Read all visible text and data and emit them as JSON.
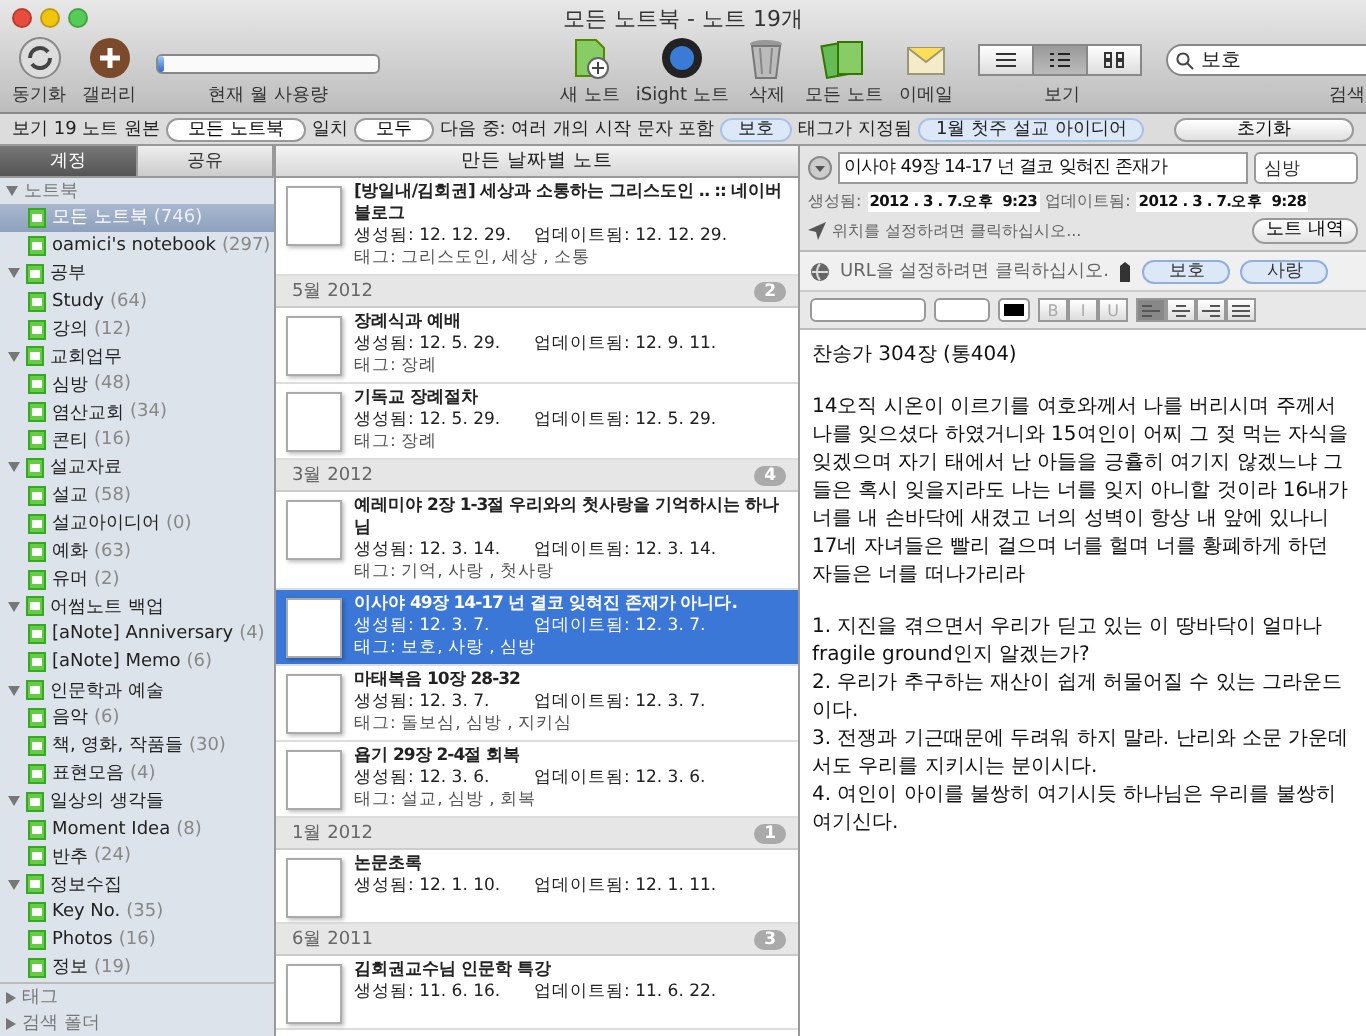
{
  "window": {
    "title": "모든 노트북 - 노트 19개"
  },
  "toolbar": {
    "items": [
      {
        "kind": "sync",
        "label": "동기화"
      },
      {
        "kind": "gallery",
        "label": "갤러리"
      }
    ],
    "usage": {
      "label": "현재 월 사용량",
      "level": 0.03
    },
    "actions": [
      {
        "kind": "new_note",
        "label": "새 노트"
      },
      {
        "kind": "isight",
        "label": "iSight 노트"
      },
      {
        "kind": "trash",
        "label": "삭제"
      },
      {
        "kind": "all_notes",
        "label": "모든 노트"
      },
      {
        "kind": "email",
        "label": "이메일"
      }
    ],
    "view": {
      "label": "보기",
      "options": [
        {
          "kind": "list",
          "selected": false
        },
        {
          "kind": "snippet",
          "selected": true
        },
        {
          "kind": "thumb",
          "selected": false
        }
      ]
    },
    "search": {
      "value": "보호",
      "label": "검색"
    }
  },
  "filter_bar": {
    "parts": [
      {
        "kind": "text",
        "text": "보기 19 노트 원본"
      },
      {
        "kind": "select",
        "text": "모든 노트북"
      },
      {
        "kind": "text",
        "text": "일치"
      },
      {
        "kind": "select",
        "text": "모두"
      },
      {
        "kind": "text",
        "text": "다음 중: 여러 개의 시작 문자 포함"
      },
      {
        "kind": "token",
        "text": "보호"
      },
      {
        "kind": "text",
        "text": "태그가 지정됨"
      },
      {
        "kind": "token",
        "text": "1월 첫주 설교 아이디어"
      }
    ],
    "reset": "초기화"
  },
  "sidebar": {
    "tabs": [
      {
        "label": "계정",
        "selected": true
      },
      {
        "label": "공유",
        "selected": false
      }
    ],
    "sections": [
      {
        "label": "노트북",
        "expanded": true,
        "children": [
          {
            "label": "모든 노트북",
            "count": "(746)",
            "selected": true
          },
          {
            "label": "oamici's notebook",
            "count": "(297)",
            "selected": false
          },
          {
            "label": "공부",
            "selected": false,
            "expanded": true,
            "children": [
              {
                "label": "Study",
                "count": "(64)",
                "selected": false
              },
              {
                "label": "강의",
                "count": "(12)",
                "selected": false
              }
            ]
          },
          {
            "label": "교회업무",
            "selected": false,
            "expanded": true,
            "children": [
              {
                "label": "심방",
                "count": "(48)",
                "selected": false
              },
              {
                "label": "염산교회",
                "count": "(34)",
                "selected": false
              },
              {
                "label": "콘티",
                "count": "(16)",
                "selected": false
              }
            ]
          },
          {
            "label": "설교자료",
            "selected": false,
            "expanded": true,
            "children": [
              {
                "label": "설교",
                "count": "(58)",
                "selected": false
              },
              {
                "label": "설교아이디어",
                "count": "(0)",
                "selected": false
              },
              {
                "label": "예화",
                "count": "(63)",
                "selected": false
              },
              {
                "label": "유머",
                "count": "(2)",
                "selected": false
              }
            ]
          },
          {
            "label": "어썸노트 백업",
            "selected": false,
            "expanded": true,
            "children": [
              {
                "label": "[aNote] Anniversary",
                "count": "(4)",
                "selected": false
              },
              {
                "label": "[aNote] Memo",
                "count": "(6)",
                "selected": false
              }
            ]
          },
          {
            "label": "인문학과 예술",
            "selected": false,
            "expanded": true,
            "children": [
              {
                "label": "음악",
                "count": "(6)",
                "selected": false
              },
              {
                "label": "책, 영화, 작품들",
                "count": "(30)",
                "selected": false
              },
              {
                "label": "표현모음",
                "count": "(4)",
                "selected": false
              }
            ]
          },
          {
            "label": "일상의 생각들",
            "selected": false,
            "expanded": true,
            "children": [
              {
                "label": "Moment Idea",
                "count": "(8)",
                "selected": false
              },
              {
                "label": "반추",
                "count": "(24)",
                "selected": false
              }
            ]
          },
          {
            "label": "정보수집",
            "selected": false,
            "expanded": true,
            "children": [
              {
                "label": "Key No.",
                "count": "(35)",
                "selected": false
              },
              {
                "label": "Photos",
                "count": "(16)",
                "selected": false
              },
              {
                "label": "정보",
                "count": "(19)",
                "selected": false
              }
            ]
          }
        ]
      },
      {
        "label": "태그",
        "expanded": false
      },
      {
        "label": "검색 폴더",
        "expanded": false
      }
    ]
  },
  "note_list": {
    "header": "만든 날짜별 노트",
    "groups": [
      {
        "notes": [
          {
            "title": "[방일내/김회권] 세상과 소통하는 그리스도인 .. :: 네이버블로그",
            "created": "생성됨: 12. 12. 29.",
            "updated": "업데이트됨: 12. 12. 29.",
            "tags": "태그: 그리스도인, 세상 , 소통",
            "selected": false
          }
        ]
      },
      {
        "label": "5월 2012",
        "count": "2",
        "notes": [
          {
            "title": "장례식과 예배",
            "created": "생성됨: 12. 5. 29.",
            "updated": "업데이트됨: 12. 9. 11.",
            "tags": "태그: 장례",
            "selected": false
          },
          {
            "title": "기독교 장례절차",
            "created": "생성됨: 12. 5. 29.",
            "updated": "업데이트됨: 12. 5. 29.",
            "tags": "태그: 장례",
            "selected": false
          }
        ]
      },
      {
        "label": "3월 2012",
        "count": "4",
        "notes": [
          {
            "title": "예레미야 2장 1-3절 우리와의 첫사랑을 기억하시는 하나님",
            "created": "생성됨: 12. 3. 14.",
            "updated": "업데이트됨: 12. 3. 14.",
            "tags": "태그: 기억, 사랑 , 첫사랑",
            "selected": false
          },
          {
            "title": "이사야 49장 14-17 넌 결코 잊혀진 존재가 아니다.",
            "created": "생성됨: 12. 3. 7.",
            "updated": "업데이트됨: 12. 3. 7.",
            "tags": "태그: 보호, 사랑 , 심방",
            "selected": true
          },
          {
            "title": "마태복음 10장 28-32",
            "created": "생성됨: 12. 3. 7.",
            "updated": "업데이트됨: 12. 3. 7.",
            "tags": "태그: 돌보심, 심방 , 지키심",
            "selected": false
          },
          {
            "title": "욥기 29장 2-4절 회복",
            "created": "생성됨: 12. 3. 6.",
            "updated": "업데이트됨: 12. 3. 6.",
            "tags": "태그: 설교, 심방 , 회복",
            "selected": false
          }
        ]
      },
      {
        "label": "1월 2012",
        "count": "1",
        "notes": [
          {
            "title": "논문초록",
            "created": "생성됨: 12. 1. 10.",
            "updated": "업데이트됨: 12. 1. 11.",
            "selected": false
          }
        ]
      },
      {
        "label": "6월 2011",
        "count": "3",
        "notes": [
          {
            "title": "김회권교수님 인문학 특강",
            "created": "생성됨: 11. 6. 16.",
            "updated": "업데이트됨: 11. 6. 22.",
            "selected": false
          }
        ]
      }
    ]
  },
  "editor": {
    "title": "이사야 49장 14-17 넌 결코 잊혀진 존재가",
    "notebook": "심방",
    "created_label": "생성됨:",
    "created": "2012 . 3 . 7.오후  9:23",
    "updated_label": "업데이트됨:",
    "updated": "2012 . 3 . 7.오후  9:28",
    "location_placeholder": "위치를 설정하려면 클릭하십시오...",
    "history_button": "노트 내역",
    "url_placeholder": "URL을 설정하려면 클릭하십시오.",
    "tags": [
      "보호",
      "사랑"
    ],
    "format": {
      "styles": [
        {
          "text": "B",
          "disabled": true
        },
        {
          "text": "I",
          "disabled": true
        },
        {
          "text": "U",
          "disabled": true
        }
      ],
      "aligns": [
        {
          "kind": "left",
          "selected": true
        },
        {
          "kind": "center",
          "selected": false
        },
        {
          "kind": "right",
          "selected": false
        },
        {
          "kind": "justify",
          "selected": false
        }
      ]
    },
    "body": [
      "찬송가 304장 (통404)",
      "14오직 시온이 이르기를 여호와께서 나를 버리시며 주께서 나를 잊으셨다 하였거니와 15여인이 어찌 그 젖 먹는 자식을 잊겠으며 자기 태에서 난 아들을 긍휼히 여기지 않겠느냐 그들은 혹시 잊을지라도 나는 너를 잊지 아니할 것이라 16내가 너를 내 손바닥에 새겼고 너의 성벽이 항상 내 앞에 있나니 17네 자녀들은 빨리 걸으며 너를 헐며 너를 황폐하게 하던 자들은 너를 떠나가리라",
      "1. 지진을 겪으면서 우리가 딛고 있는 이 땅바닥이 얼마나 fragile ground인지 알겠는가?\n2. 우리가 추구하는 재산이 쉽게 허물어질 수 있는 그라운드이다.\n3. 전쟁과 기근때문에 두려워 하지 말라. 난리와 소문 가운데서도 우리를 지키시는 분이시다.\n4. 여인이 아이를 불쌍히 여기시듯 하나님은 우리를 불쌍히 여기신다."
    ]
  }
}
